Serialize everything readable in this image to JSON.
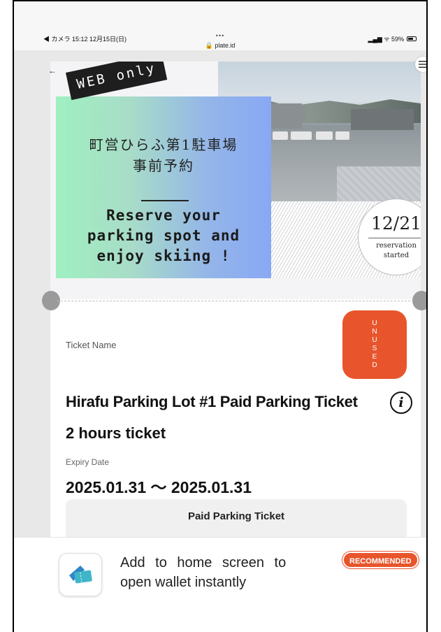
{
  "status_bar": {
    "left": "◀ カメラ  15:12  12月15日(日)",
    "dots": "•••",
    "url": "🔒 plate.id",
    "signal": "▂▄▆ ᯤ 59%",
    "battery_pct": 59
  },
  "banner": {
    "web_only": "WEB only",
    "jp_title_line1": "町営ひらふ第1駐車場",
    "jp_title_line2": "事前予約",
    "en_title_line1": "Reserve your",
    "en_title_line2": "parking spot and",
    "en_title_line3": "enjoy skiing !",
    "date": "12/21",
    "date_caption_line1": "reservation",
    "date_caption_line2": "started"
  },
  "nav": {
    "back": "←"
  },
  "ticket": {
    "name_label": "Ticket Name",
    "status_letters": [
      "U",
      "N",
      "U",
      "S",
      "E",
      "D"
    ],
    "title": "Hirafu Parking Lot #1 Paid Parking Ticket",
    "info_icon": "i",
    "subtitle": "2 hours ticket",
    "expiry_label": "Expiry Date",
    "expiry_value": "2025.01.31 ～ 2025.01.31",
    "section_label": "Paid Parking Ticket"
  },
  "install_banner": {
    "line1": "Add to home screen to",
    "line2": "open wallet instantly",
    "badge": "RECOMMENDED"
  },
  "colors": {
    "accent": "#e8552c",
    "dark": "#1e1e1e"
  }
}
